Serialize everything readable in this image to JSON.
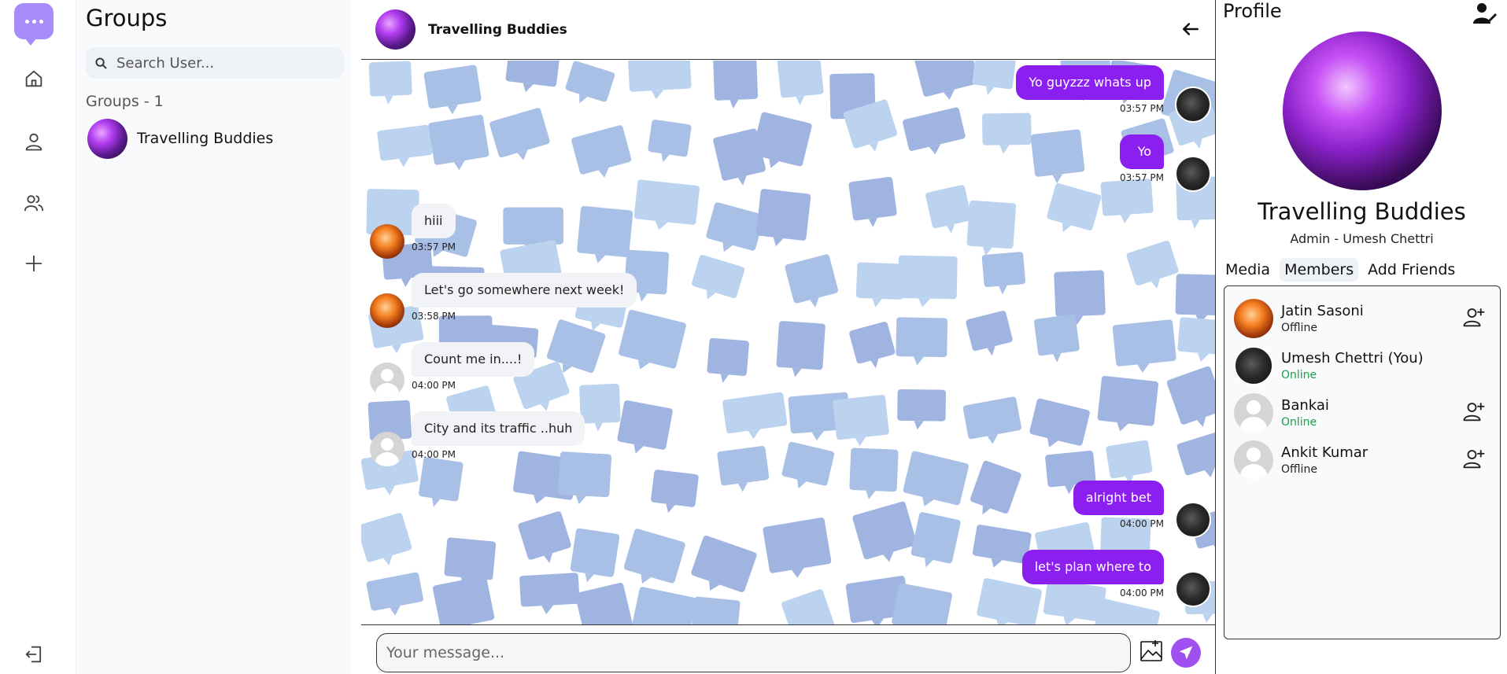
{
  "app": {
    "accent": "#8b1ff0",
    "online_color": "#16a34a"
  },
  "groups": {
    "title": "Groups",
    "search_placeholder": "Search User...",
    "count_label": "Groups - 1",
    "items": [
      {
        "name": "Travelling Buddies",
        "avatar": "purple"
      }
    ]
  },
  "chat": {
    "title": "Travelling Buddies",
    "messages": [
      {
        "text": "Yo guyzzz whats up",
        "time": "03:57 PM",
        "dir": "out",
        "avatar": "dark"
      },
      {
        "text": "Yo",
        "time": "03:57 PM",
        "dir": "out",
        "avatar": "dark"
      },
      {
        "text": "hiii",
        "time": "03:57 PM",
        "dir": "in",
        "avatar": "orange"
      },
      {
        "text": "Let's go somewhere next week!",
        "time": "03:58 PM",
        "dir": "in",
        "avatar": "orange"
      },
      {
        "text": "Count me in....!",
        "time": "04:00 PM",
        "dir": "in",
        "avatar": "grey"
      },
      {
        "text": "City and its traffic ..huh",
        "time": "04:00 PM",
        "dir": "in",
        "avatar": "grey"
      },
      {
        "text": "alright bet",
        "time": "04:00 PM",
        "dir": "out",
        "avatar": "dark"
      },
      {
        "text": "let's plan where to",
        "time": "04:00 PM",
        "dir": "out",
        "avatar": "dark"
      }
    ],
    "composer_placeholder": "Your message..."
  },
  "profile": {
    "title": "Profile",
    "name": "Travelling Buddies",
    "admin": "Admin - Umesh Chettri",
    "tabs": [
      {
        "label": "Media",
        "active": false
      },
      {
        "label": "Members",
        "active": true
      },
      {
        "label": "Add Friends",
        "active": false
      }
    ],
    "members": [
      {
        "name": "Jatin Sasoni",
        "status": "Offline",
        "avatar": "orange",
        "addable": true
      },
      {
        "name": "Umesh Chettri (You)",
        "status": "Online",
        "avatar": "dark",
        "addable": false
      },
      {
        "name": "Bankai",
        "status": "Online",
        "avatar": "grey",
        "addable": true
      },
      {
        "name": "Ankit Kumar",
        "status": "Offline",
        "avatar": "grey",
        "addable": true
      }
    ]
  }
}
